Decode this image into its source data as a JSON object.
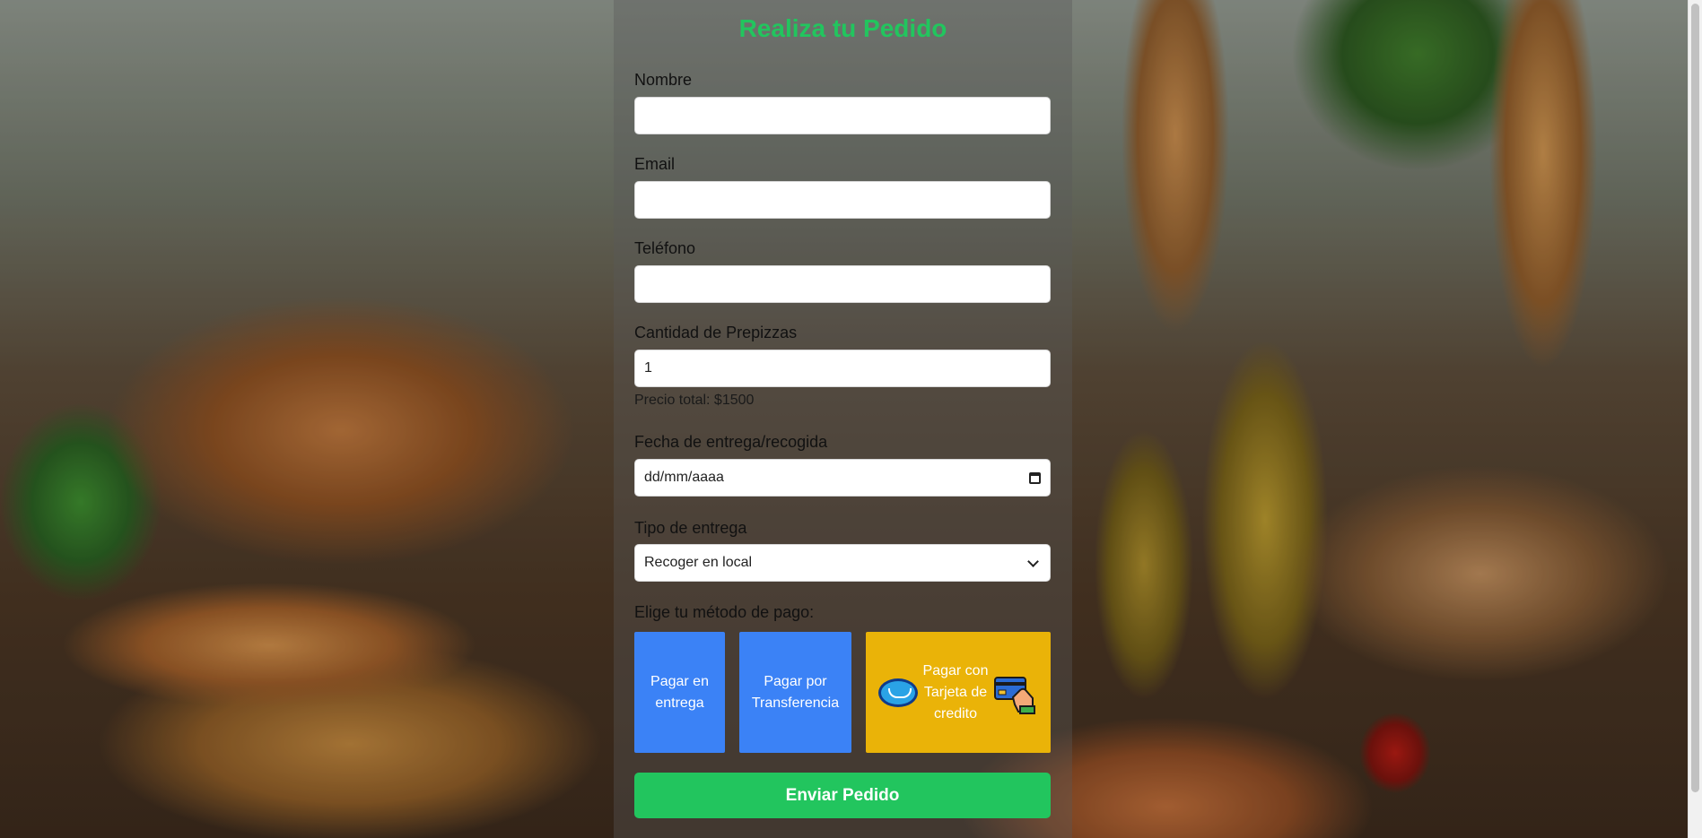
{
  "form": {
    "title": "Realiza tu Pedido",
    "fields": {
      "name": {
        "label": "Nombre",
        "value": ""
      },
      "email": {
        "label": "Email",
        "value": ""
      },
      "phone": {
        "label": "Teléfono",
        "value": ""
      },
      "quantity": {
        "label": "Cantidad de Prepizzas",
        "value": "1"
      },
      "date": {
        "label": "Fecha de entrega/recogida",
        "placeholder": "dd/mm/aaaa",
        "icon": "calendar-icon"
      },
      "delivery": {
        "label": "Tipo de entrega",
        "selected": "Recoger en local",
        "icon": "chevron-down-icon"
      }
    },
    "price_text": "Precio total: $1500",
    "payment": {
      "label": "Elige tu método de pago:",
      "cash_label": "Pagar en entrega",
      "transfer_label": "Pagar por Transferencia",
      "card_label": "Pagar con Tarjeta de credito",
      "card_icons": [
        "mercadopago-icon",
        "credit-card-icon"
      ]
    },
    "submit_label": "Enviar Pedido"
  },
  "colors": {
    "accent": "#22c55e",
    "payment_blue": "#3b82f6",
    "payment_yellow": "#eab308"
  }
}
